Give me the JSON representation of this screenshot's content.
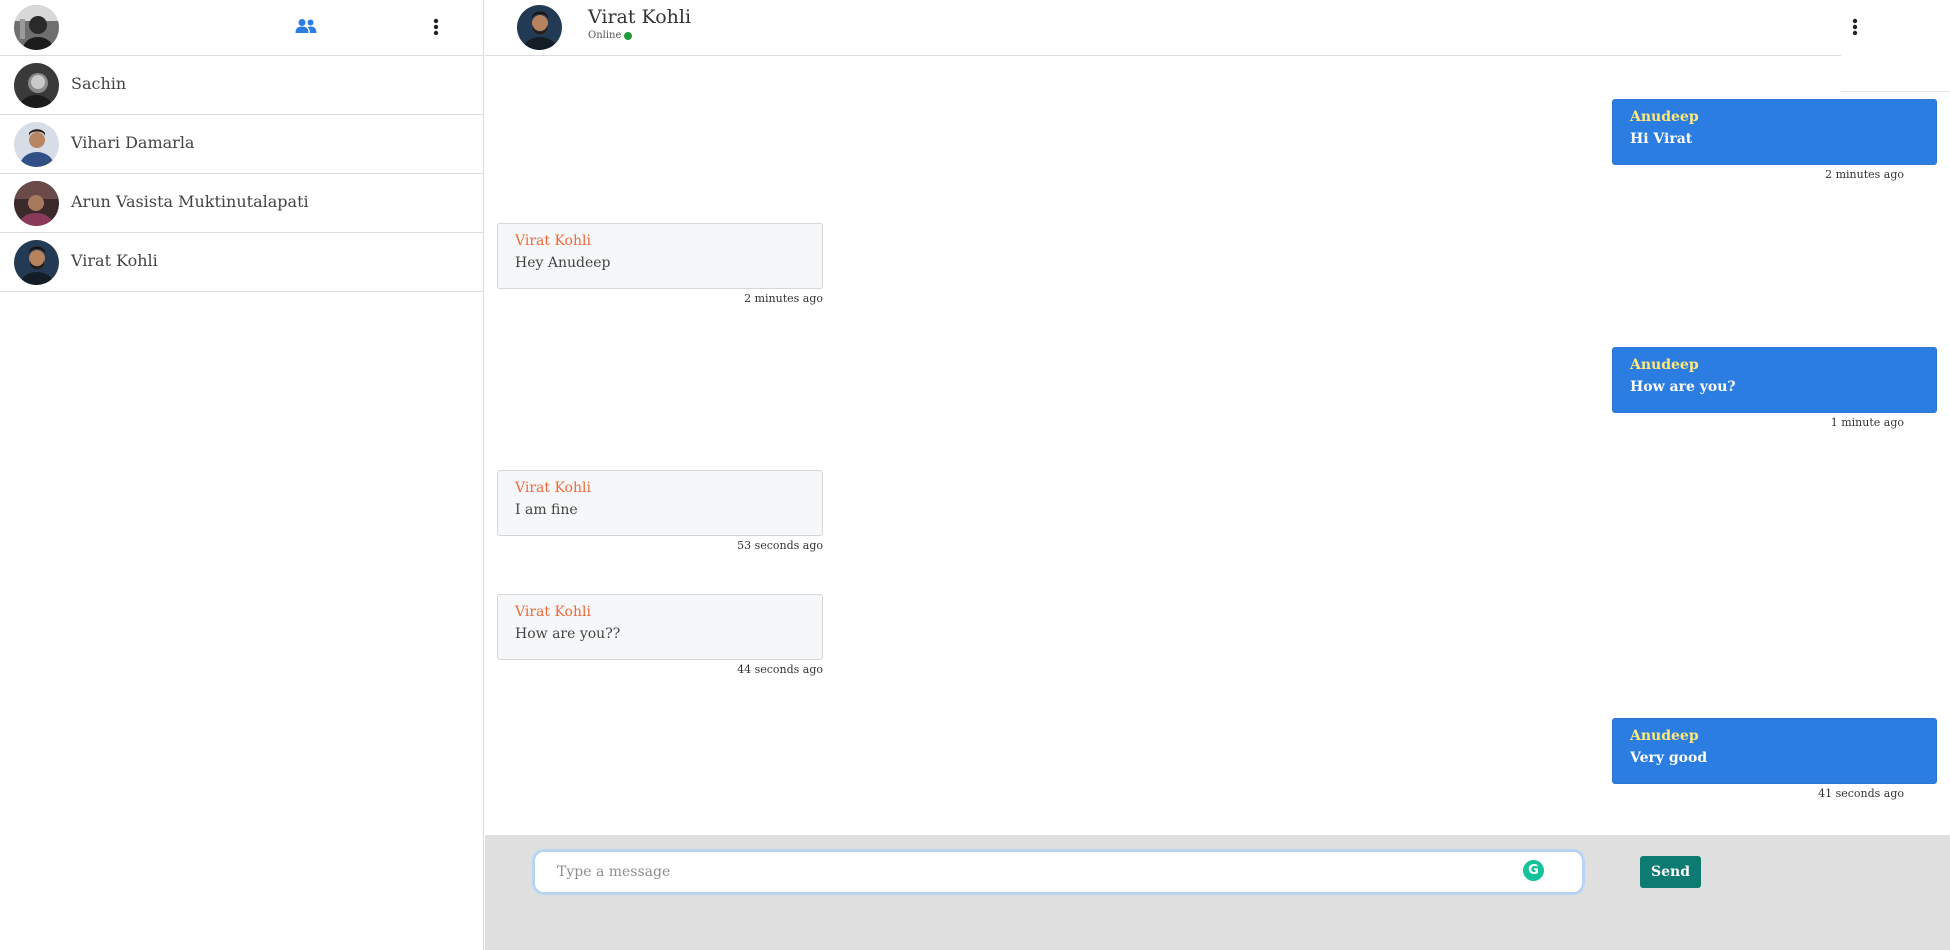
{
  "me": {
    "avatar": "user-avatar"
  },
  "sidebar": {
    "icons": {
      "people": "people-icon",
      "menu": "more-vertical-icon"
    },
    "contacts": [
      {
        "name": "Sachin"
      },
      {
        "name": "Vihari Damarla"
      },
      {
        "name": "Arun Vasista Muktinutalapati"
      },
      {
        "name": "Virat Kohli"
      }
    ]
  },
  "chat": {
    "title": "Virat Kohli",
    "status": "Online",
    "messages": [
      {
        "sender": "Anudeep",
        "text": "Hi Virat",
        "time": "2 minutes ago",
        "outgoing": true
      },
      {
        "sender": "Virat Kohli",
        "text": "Hey Anudeep",
        "time": "2 minutes ago",
        "outgoing": false
      },
      {
        "sender": "Anudeep",
        "text": "How are you?",
        "time": "1 minute ago",
        "outgoing": true
      },
      {
        "sender": "Virat Kohli",
        "text": "I am fine",
        "time": "53 seconds ago",
        "outgoing": false
      },
      {
        "sender": "Virat Kohli",
        "text": "How are you??",
        "time": "44 seconds ago",
        "outgoing": false
      },
      {
        "sender": "Anudeep",
        "text": "Very good",
        "time": "41 seconds ago",
        "outgoing": true
      }
    ]
  },
  "composer": {
    "placeholder": "Type a message",
    "value": "",
    "send_label": "Send",
    "grammarly_glyph": "G"
  },
  "colors": {
    "outgoing_bubble": "#2b7de1",
    "outgoing_sender": "#ffe878",
    "incoming_sender": "#f0683a",
    "send_button": "#0e7b72",
    "online": "#1e9a3a"
  }
}
